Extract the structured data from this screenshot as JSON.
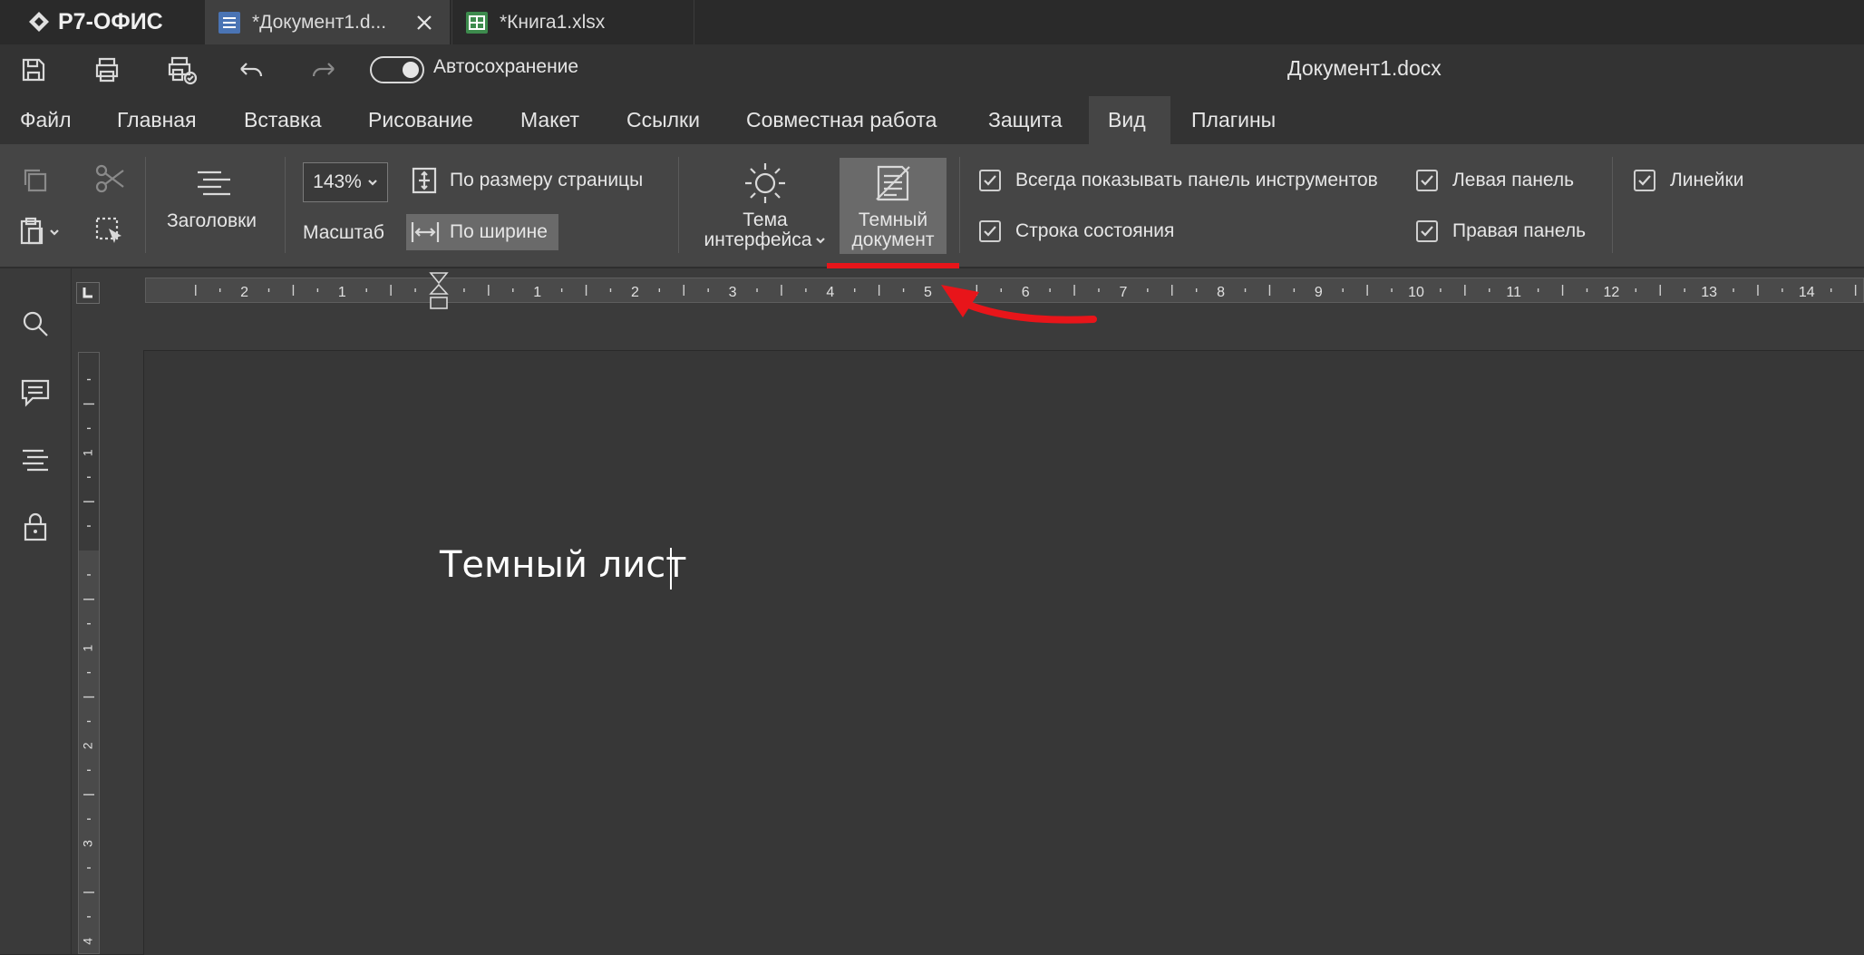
{
  "app": {
    "logo_text": "Р7-ОФИС",
    "tabs": [
      {
        "label": "*Документ1.d...",
        "type": "document",
        "active": true
      },
      {
        "label": "*Книга1.xlsx",
        "type": "spreadsheet",
        "active": false
      }
    ]
  },
  "quick_access": {
    "autosave_label": "Автосохранение",
    "autosave_on": true,
    "document_title": "Документ1.docx"
  },
  "menu": {
    "items": [
      "Файл",
      "Главная",
      "Вставка",
      "Рисование",
      "Макет",
      "Ссылки",
      "Совместная работа",
      "Защита",
      "Вид",
      "Плагины"
    ],
    "active": "Вид"
  },
  "ribbon": {
    "headings_label": "Заголовки",
    "zoom_value": "143%",
    "zoom_label": "Масштаб",
    "fit_page_label": "По размеру страницы",
    "fit_width_label": "По ширине",
    "theme_label_1": "Тема",
    "theme_label_2": "интерфейса",
    "dark_doc_label_1": "Темный",
    "dark_doc_label_2": "документ",
    "checkboxes": [
      {
        "label": "Всегда показывать панель инструментов",
        "checked": true
      },
      {
        "label": "Строка состояния",
        "checked": true
      },
      {
        "label": "Левая панель",
        "checked": true
      },
      {
        "label": "Правая панель",
        "checked": true
      },
      {
        "label": "Линейки",
        "checked": true
      }
    ]
  },
  "ruler": {
    "h_labels": [
      "2",
      "1",
      "1",
      "2",
      "3",
      "4",
      "5",
      "6",
      "7",
      "8",
      "9",
      "10",
      "11",
      "12",
      "13",
      "14"
    ],
    "v_labels": [
      "1",
      "1",
      "2",
      "3",
      "4"
    ]
  },
  "document": {
    "text": "Темный лист"
  },
  "colors": {
    "background": "#2b2b2b",
    "ribbon": "#454545",
    "annotation_red": "#e8151a"
  }
}
